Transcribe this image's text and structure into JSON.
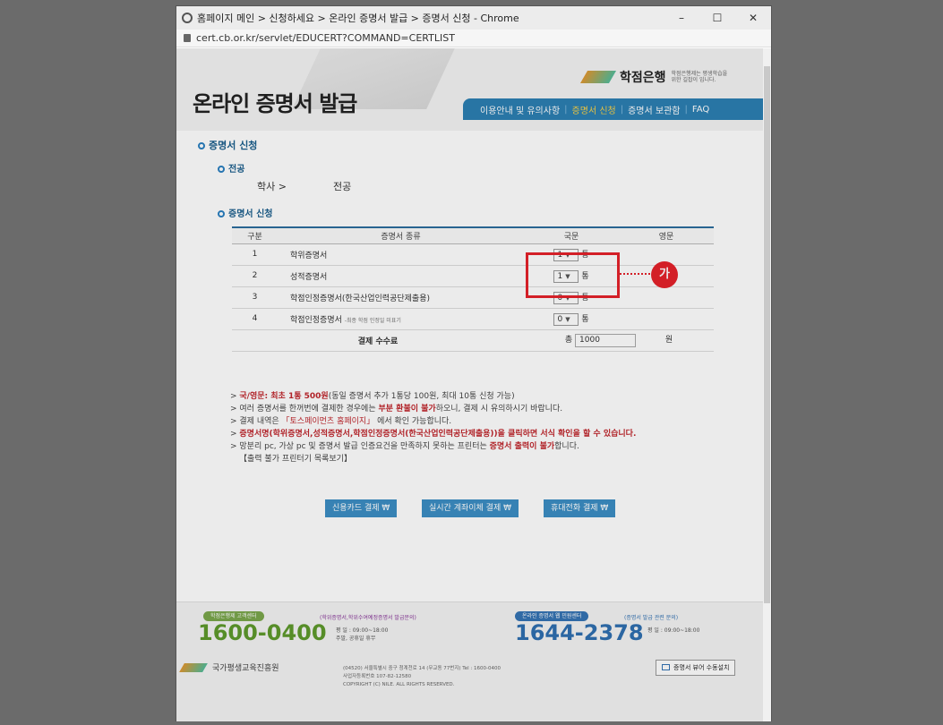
{
  "window": {
    "title": "홈페이지 메인 > 신청하세요 > 온라인 증명서 발급 > 증명서 신청 - Chrome",
    "url": "cert.cb.or.kr/servlet/EDUCERT?COMMAND=CERTLIST",
    "controls": {
      "minimize": "–",
      "maximize": "☐",
      "close": "✕"
    }
  },
  "header": {
    "page_title": "온라인 증명서 발급",
    "logo_text": "학점은행",
    "logo_sub": "학점은행제는 평생학습을 위한 길잡이 입니다.",
    "nav": [
      "이용안내 및 유의사항",
      "증명서 신청",
      "증명서 보관함",
      "FAQ"
    ],
    "nav_active_index": 1
  },
  "section": {
    "main": "증명서 신청",
    "major_title": "전공",
    "degree": "학사 >",
    "major": "전공",
    "apply_title": "증명서 신청"
  },
  "table": {
    "headers": [
      "구분",
      "증명서 종류",
      "국문",
      "영문"
    ],
    "rows": [
      {
        "no": "1",
        "name": "학위증명서",
        "qty": "1",
        "unit": "통"
      },
      {
        "no": "2",
        "name": "성적증명서",
        "qty": "1",
        "unit": "통"
      },
      {
        "no": "3",
        "name": "학점인정증명서(한국산업인력공단제출용)",
        "qty": "0",
        "unit": "통"
      },
      {
        "no": "4",
        "name": "학점인정증명서",
        "note": "-최종 학점 인정일 미표기",
        "qty": "0",
        "unit": "통"
      }
    ],
    "fee_label": "결제 수수료",
    "fee_prefix": "총",
    "fee_value": "1000",
    "fee_unit": "원"
  },
  "callout": {
    "label": "가"
  },
  "notes": [
    {
      "red": "국/영문: 최초 1통 500원",
      "rest": "(동일 증명서 추가 1통당 100원, 최대 10통 신청 가능)"
    },
    {
      "pre": "여러 증명서를 한꺼번에 결제한 경우에는 ",
      "red": "부분 환불이 불가",
      "rest": "하오니, 결제 시 유의하시기 바랍니다."
    },
    {
      "pre": "결제 내역은 ",
      "red": "「토스페이먼츠 홈페이지」",
      "rest": " 에서 확인 가능합니다."
    },
    {
      "red": "증명서명(학위증명서,성적증명서,학점인정증명서(한국산업인력공단제출용))을 클릭하면 서식 확인을 할 수 있습니다."
    },
    {
      "pre": "망분리 pc, 가상 pc 및 증명서 발급 인증요건을 만족하지 못하는 프린터는 ",
      "red": "증명서 출력이 불가",
      "rest": "합니다."
    },
    {
      "pre": "【출력 불가 프린터기 목록보기】"
    }
  ],
  "pay_buttons": [
    "신용카드 결제 ₩",
    "실시간 계좌이체 결제 ₩",
    "휴대전화 결제 ₩"
  ],
  "footer": {
    "center1_badge": "학점은행제 고객센터",
    "center1_sub": "(학위증명서,학위수여예정증명서 발급문의)",
    "center1_phone": "1600-0400",
    "center1_hours": "평 일 : 09:00~18:00",
    "center1_hours2": "주말, 공휴일 휴무",
    "center2_badge": "온라인 증명서 웹 민원센터",
    "center2_sub": "(증명서 발급 관련 문의)",
    "center2_phone": "1644-2378",
    "center2_hours": "평 일 : 09:00~18:00",
    "org": "국가평생교육진흥원",
    "address1": "(04520) 서울특별시 중구 청계천로 14 (무교동 77번지)   Tel : 1600-0400",
    "address2": "사업자등록번호 107-82-12580",
    "address3": "COPYRIGHT (C) NILE. ALL RIGHTS RESERVED.",
    "install_button": "증명서 뷰어 수동설치"
  }
}
